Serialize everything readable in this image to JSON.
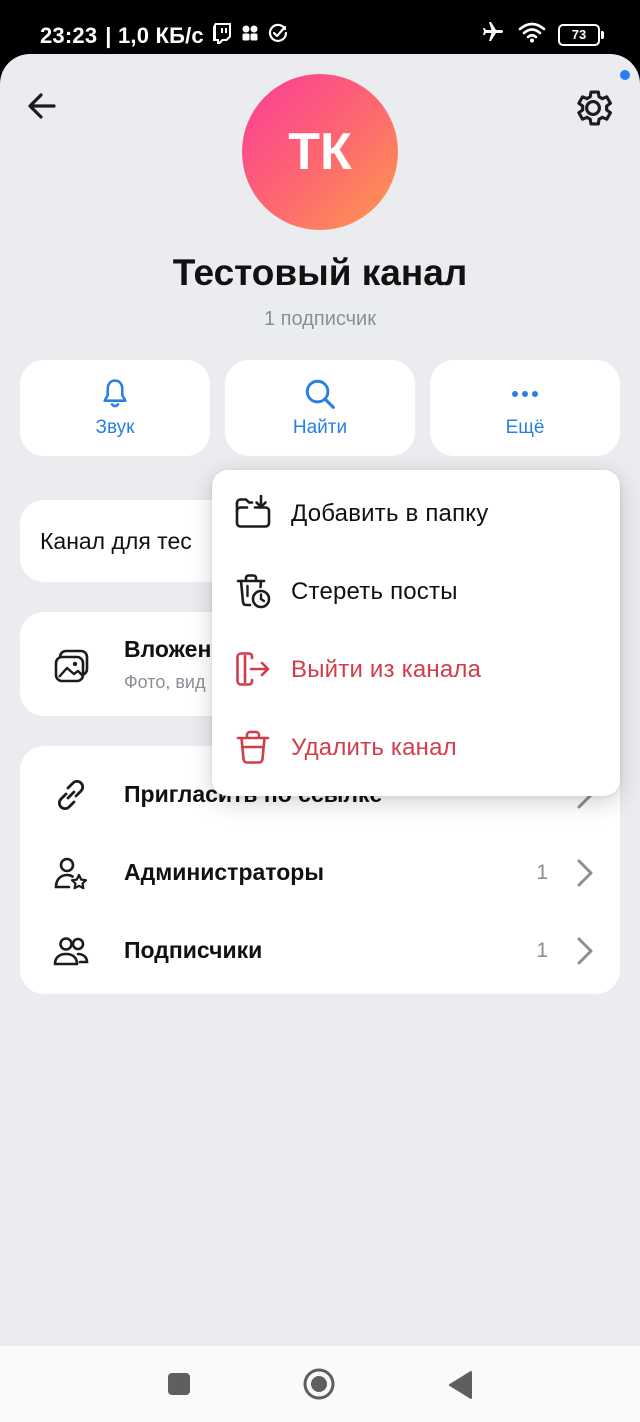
{
  "status": {
    "time": "23:23",
    "speed": "| 1,0 КБ/с",
    "battery": "73",
    "icons": [
      "twitch-icon",
      "grid-app-icon",
      "check-circle-icon",
      "airplane-icon",
      "wifi-icon",
      "battery-icon"
    ]
  },
  "header": {
    "avatar_initials": "ТК",
    "channel_name": "Тестовый канал",
    "subscribers": "1 подписчик",
    "icons": [
      "back-arrow-icon",
      "gear-icon"
    ]
  },
  "actions": [
    {
      "label": "Звук",
      "icon": "bell-icon"
    },
    {
      "label": "Найти",
      "icon": "search-icon"
    },
    {
      "label": "Ещё",
      "icon": "more-dots-icon"
    }
  ],
  "about": {
    "text": "Канал для тес"
  },
  "media": {
    "title": "Вложен",
    "subtitle": "Фото, вид",
    "icon": "gallery-icon"
  },
  "list": [
    {
      "label": "Пригласить по ссылке",
      "count": "",
      "icon": "link-icon"
    },
    {
      "label": "Администраторы",
      "count": "1",
      "icon": "admin-star-icon"
    },
    {
      "label": "Подписчики",
      "count": "1",
      "icon": "users-icon"
    }
  ],
  "menu": {
    "items": [
      {
        "label": "Добавить в папку",
        "icon": "folder-add-icon",
        "danger": false
      },
      {
        "label": "Стереть посты",
        "icon": "trash-clock-icon",
        "danger": false
      },
      {
        "label": "Выйти из канала",
        "icon": "exit-icon",
        "danger": true
      },
      {
        "label": "Удалить канал",
        "icon": "trash-icon",
        "danger": true
      }
    ]
  },
  "colors": {
    "accent": "#2a7fe2",
    "danger": "#d23d4a",
    "background": "#ebecf0",
    "avatar_gradient": [
      "#fb3a9b",
      "#ff9a4e"
    ]
  },
  "navbar": {
    "icons": [
      "recents-square-icon",
      "home-circle-icon",
      "back-triangle-icon"
    ]
  }
}
